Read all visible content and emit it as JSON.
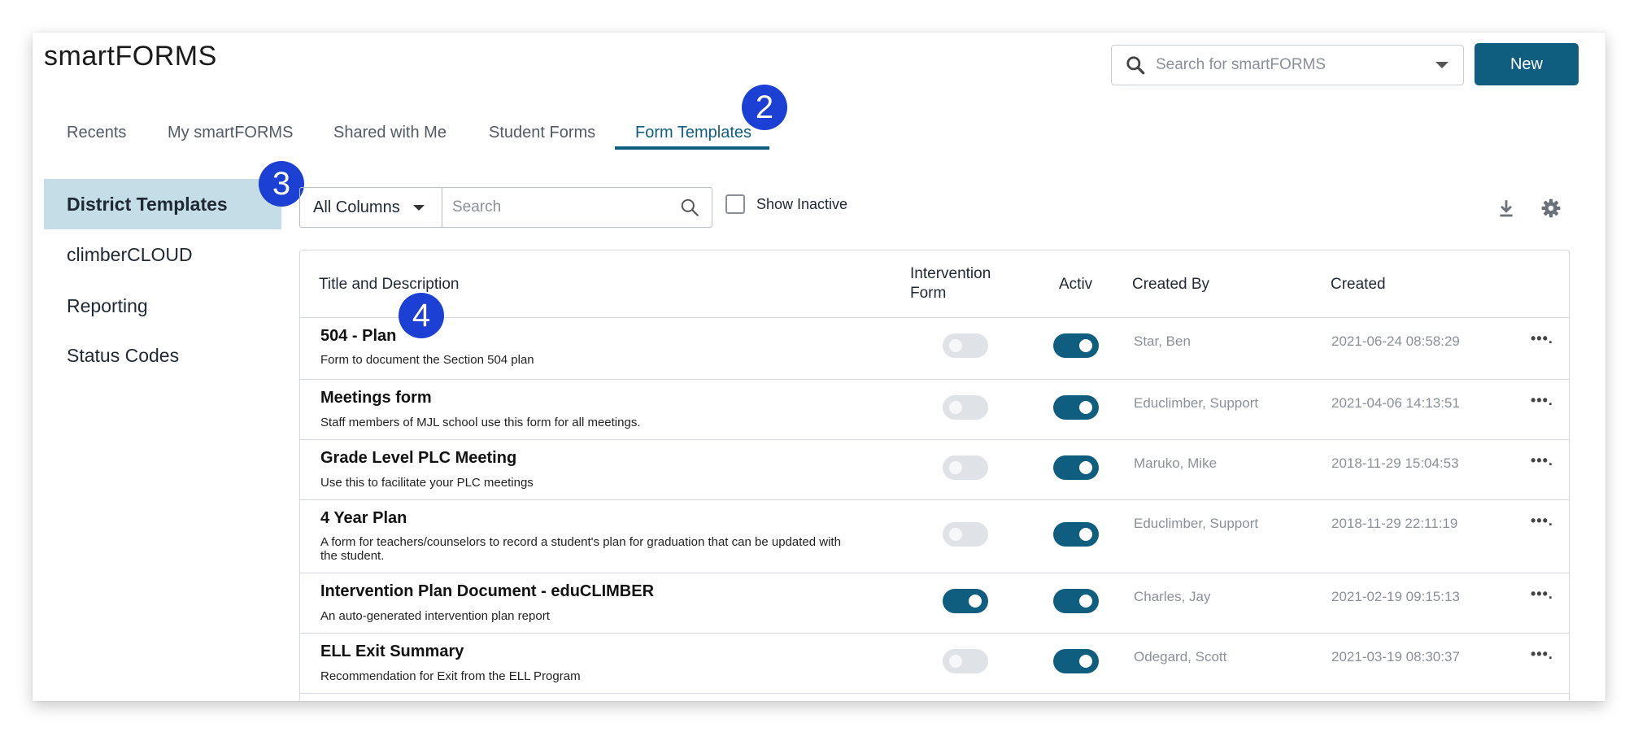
{
  "app": {
    "title": "smartFORMS"
  },
  "top_search": {
    "placeholder": "Search for smartFORMS"
  },
  "new_button": {
    "label": "New"
  },
  "tabs": [
    {
      "label": "Recents",
      "active": false
    },
    {
      "label": "My smartFORMS",
      "active": false
    },
    {
      "label": "Shared with Me",
      "active": false
    },
    {
      "label": "Student Forms",
      "active": false
    },
    {
      "label": "Form Templates",
      "active": true
    }
  ],
  "sidebar": {
    "items": [
      {
        "label": "District Templates",
        "active": true
      },
      {
        "label": "climberCLOUD",
        "active": false
      },
      {
        "label": "Reporting",
        "active": false
      },
      {
        "label": "Status Codes",
        "active": false
      }
    ]
  },
  "filter": {
    "column_select": "All Columns",
    "search_placeholder": "Search",
    "show_inactive_label": "Show Inactive",
    "show_inactive_checked": false
  },
  "table": {
    "headers": {
      "title": "Title and Description",
      "intervention_line1": "Intervention",
      "intervention_line2": "Form",
      "active": "Activ",
      "created_by": "Created By",
      "created": "Created"
    },
    "rows": [
      {
        "title": "504 - Plan",
        "description": "Form to document the Section 504 plan",
        "intervention": false,
        "active": true,
        "created_by": "Star, Ben",
        "created": "2021-06-24 08:58:29",
        "more": "•••."
      },
      {
        "title": "Meetings form",
        "description": "Staff members of MJL school use this form for all meetings.",
        "intervention": false,
        "active": true,
        "created_by": "Educlimber, Support",
        "created": "2021-04-06 14:13:51",
        "more": "•••."
      },
      {
        "title": "Grade Level PLC Meeting",
        "description": "Use this to facilitate your PLC meetings",
        "intervention": false,
        "active": true,
        "created_by": "Maruko, Mike",
        "created": "2018-11-29 15:04:53",
        "more": "•••."
      },
      {
        "title": "4 Year Plan",
        "description": "A form for teachers/counselors to record a student's plan for graduation that can be updated with the student.",
        "intervention": false,
        "active": true,
        "created_by": "Educlimber, Support",
        "created": "2018-11-29 22:11:19",
        "more": "•••."
      },
      {
        "title": "Intervention Plan Document - eduCLIMBER",
        "description": "An auto-generated intervention plan report",
        "intervention": true,
        "active": true,
        "created_by": "Charles, Jay",
        "created": "2021-02-19 09:15:13",
        "more": "•••."
      },
      {
        "title": "ELL Exit Summary",
        "description": "Recommendation for Exit from the ELL Program",
        "intervention": false,
        "active": true,
        "created_by": "Odegard, Scott",
        "created": "2021-03-19 08:30:37",
        "more": "•••."
      }
    ]
  },
  "callouts": {
    "tabs": "2",
    "sidebar": "3",
    "table": "4"
  },
  "colors": {
    "brand": "#0f5e80",
    "sidebar_active_bg": "#c5dde6",
    "callout": "#1c3fd4",
    "toggle_off": "#dfe2e6",
    "muted_text": "#8a9099"
  },
  "icons": {
    "top_search": "search-icon",
    "filter_search": "search-icon",
    "download": "download-icon",
    "settings": "gear-icon"
  }
}
